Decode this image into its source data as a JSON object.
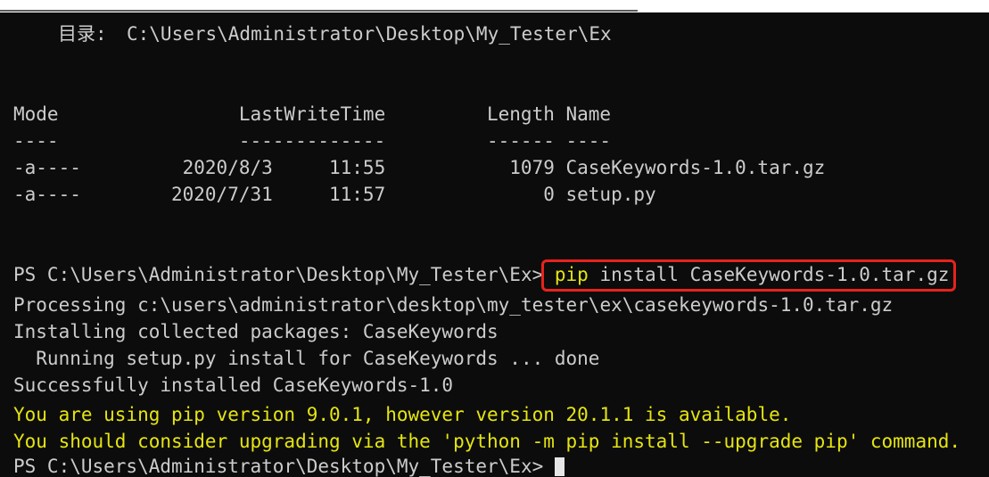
{
  "colors": {
    "background": "#0c0c0c",
    "text": "#cccccc",
    "yellow": "#e5e510",
    "highlight": "#e8231c",
    "cursor": "#e6e6e6"
  },
  "terminal": {
    "directory": {
      "label": "目录:",
      "path": "C:\\Users\\Administrator\\Desktop\\My_Tester\\Ex"
    },
    "listing": {
      "columns": {
        "mode": "Mode",
        "last_write_time": "LastWriteTime",
        "length": "Length",
        "name": "Name"
      },
      "separators": {
        "mode": "----",
        "last_write_time": "-------------",
        "length": "------",
        "name": "----"
      },
      "rows": [
        {
          "mode": "-a----",
          "date": "2020/8/3",
          "time": "11:55",
          "length": "1079",
          "name": "CaseKeywords-1.0.tar.gz"
        },
        {
          "mode": "-a----",
          "date": "2020/7/31",
          "time": "11:57",
          "length": "0",
          "name": "setup.py"
        }
      ]
    },
    "command_prompt": {
      "path": "PS C:\\Users\\Administrator\\Desktop\\My_Tester\\Ex>",
      "command": "pip",
      "arguments": "install CaseKeywords-1.0.tar.gz"
    },
    "output": [
      "Processing c:\\users\\administrator\\desktop\\my_tester\\ex\\casekeywords-1.0.tar.gz",
      "Installing collected packages: CaseKeywords",
      "  Running setup.py install for CaseKeywords ... done",
      "Successfully installed CaseKeywords-1.0"
    ],
    "warnings": [
      "You are using pip version 9.0.1, however version 20.1.1 is available.",
      "You should consider upgrading via the 'python -m pip install --upgrade pip' command."
    ],
    "current_prompt": {
      "path": "PS C:\\Users\\Administrator\\Desktop\\My_Tester\\Ex>"
    }
  }
}
